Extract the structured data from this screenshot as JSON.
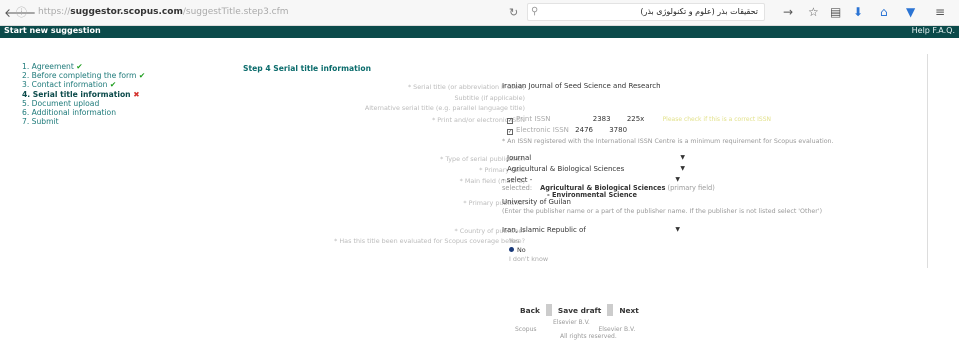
{
  "browser": {
    "back_icon": "back-arrow-icon",
    "url_prefix": "suggestor.scopus.com",
    "url_domain": "suggestor.scopus.com",
    "url_path": "/suggestTitle.step3.cfm",
    "search_query": "تحقیقات بذر (علوم و تکنولوژی بذر)"
  },
  "header": {
    "title": "Start new suggestion",
    "help": "Help",
    "faq": "F.A.Q."
  },
  "steps": [
    {
      "label": "1. Agreement",
      "status": "done"
    },
    {
      "label": "2. Before completing the form",
      "status": "done"
    },
    {
      "label": "3. Contact information",
      "status": "done"
    },
    {
      "label": "4. Serial title information",
      "status": "error"
    },
    {
      "label": "5. Document upload",
      "status": ""
    },
    {
      "label": "6. Additional information",
      "status": ""
    },
    {
      "label": "7. Submit",
      "status": ""
    }
  ],
  "form": {
    "step_title": "Step 4   Serial title information",
    "serial_title_label": "* Serial title (or abbreviation if used)",
    "serial_title_value": "Iranian Journal of Seed Science and Research",
    "subtitle_label": "Subtitle (if applicable)",
    "alt_title_label": "Alternative serial title (e.g. parallel language title)",
    "issn_label": "* Print and/or electronic ISSN",
    "print_issn_label": "Print ISSN",
    "print_issn_1": "2383",
    "print_issn_2": "225x",
    "issn_hint": "Please check if this is a correct ISSN",
    "e_issn_label": "Electronic ISSN",
    "e_issn_1": "2476",
    "e_issn_2": "3780",
    "issn_note": "* An ISSN registered with the International ISSN Centre is a minimum requirement for Scopus evaluation.",
    "type_label": "* Type of serial publication",
    "type_value": "Journal",
    "primary_field_label": "* Primary field",
    "primary_field_value": "Agricultural & Biological Sciences",
    "main_field_label": "* Main field (max. 3)",
    "main_field_value": "- select -",
    "selected_label": "selected:",
    "selected_1": "Agricultural & Biological Sciences",
    "selected_1_note": "(primary field)",
    "selected_2": "- Environmental Science",
    "publisher_label": "* Primary publisher",
    "publisher_value": "University of Guilan",
    "publisher_note": "(Enter the publisher name or a part of the publisher name. If the publisher is not listed select 'Other')",
    "country_label": "* Country of publisher",
    "country_value": "Iran, Islamic Republic of",
    "previous_label": "* Has this title been evaluated for Scopus coverage before?",
    "radio_yes": "Yes",
    "radio_no": "No",
    "radio_unknown": "I don't know"
  },
  "buttons": {
    "back": "Back",
    "save_draft": "Save draft",
    "next": "Next"
  },
  "footer": {
    "line1": "Elsevier B.V.",
    "line2_a": "Scopus",
    "line2_b": "Elsevier B.V.",
    "line3": "All rights reserved."
  }
}
